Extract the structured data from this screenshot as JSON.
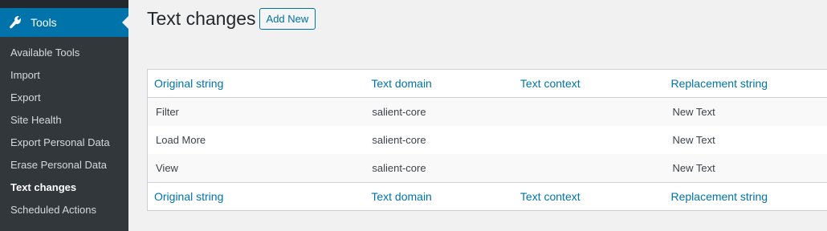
{
  "sidebar": {
    "active_menu": {
      "label": "Tools",
      "icon": "wrench-icon"
    },
    "items": [
      {
        "label": "Available Tools",
        "current": false
      },
      {
        "label": "Import",
        "current": false
      },
      {
        "label": "Export",
        "current": false
      },
      {
        "label": "Site Health",
        "current": false
      },
      {
        "label": "Export Personal Data",
        "current": false
      },
      {
        "label": "Erase Personal Data",
        "current": false
      },
      {
        "label": "Text changes",
        "current": true
      },
      {
        "label": "Scheduled Actions",
        "current": false
      }
    ]
  },
  "page": {
    "title": "Text changes",
    "add_new_label": "Add New"
  },
  "table": {
    "columns": [
      "Original string",
      "Text domain",
      "Text context",
      "Replacement string"
    ],
    "rows": [
      {
        "original": "Filter",
        "domain": "salient-core",
        "context": "",
        "replacement": "New Text"
      },
      {
        "original": "Load More",
        "domain": "salient-core",
        "context": "",
        "replacement": "New Text"
      },
      {
        "original": "View",
        "domain": "salient-core",
        "context": "",
        "replacement": "New Text"
      }
    ]
  },
  "colors": {
    "sidebar_bg": "#23282d",
    "submenu_bg": "#32373c",
    "accent": "#0073aa",
    "link": "#0073aa"
  }
}
